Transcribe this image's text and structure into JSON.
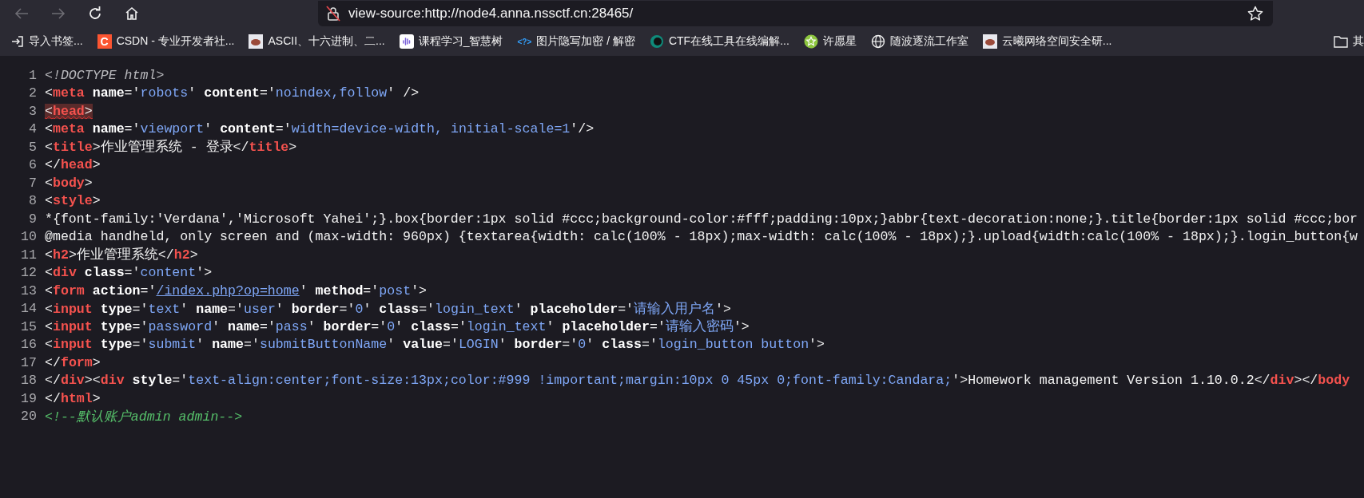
{
  "toolbar": {
    "back": {
      "disabled": true
    },
    "forward": {
      "disabled": true
    },
    "address": {
      "value": "view-source:http://node4.anna.nssctf.cn:28465/",
      "secure": false
    }
  },
  "bookmarks": [
    {
      "kind": "import",
      "label": "导入书签..."
    },
    {
      "kind": "letter",
      "letter": "C",
      "color": "#fc5531",
      "label": "CSDN - 专业开发者社..."
    },
    {
      "kind": "image",
      "label": "ASCII、十六进制、二..."
    },
    {
      "kind": "bars",
      "label": "课程学习_智慧树"
    },
    {
      "kind": "code",
      "icon_text": "<?>",
      "label": "图片隐写加密 / 解密"
    },
    {
      "kind": "ring",
      "label": "CTF在线工具在线编解..."
    },
    {
      "kind": "star",
      "label": "许愿星"
    },
    {
      "kind": "globe",
      "label": "随波逐流工作室"
    },
    {
      "kind": "image",
      "label": "云曦网络空间安全研..."
    },
    {
      "kind": "folder",
      "label": "其"
    }
  ],
  "source": {
    "lines": [
      {
        "number": "1",
        "error": false,
        "tokens": [
          {
            "kind": "doctype",
            "text": "<!DOCTYPE html>"
          }
        ]
      },
      {
        "number": "2",
        "error": false,
        "tokens": [
          {
            "kind": "punct",
            "text": "<"
          },
          {
            "kind": "tag",
            "text": "meta"
          },
          {
            "kind": "attr",
            "text": "name"
          },
          {
            "kind": "punct",
            "text": "='"
          },
          {
            "kind": "value",
            "text": "robots"
          },
          {
            "kind": "punct",
            "text": "' "
          },
          {
            "kind": "attr",
            "text": "content"
          },
          {
            "kind": "punct",
            "text": "='"
          },
          {
            "kind": "value",
            "text": "noindex,follow"
          },
          {
            "kind": "punct",
            "text": "' />"
          }
        ]
      },
      {
        "number": "3",
        "error": true,
        "tokens": [
          {
            "kind": "punct",
            "text": "<"
          },
          {
            "kind": "tag",
            "text": "head"
          },
          {
            "kind": "punct",
            "text": ">"
          }
        ]
      },
      {
        "number": "4",
        "error": false,
        "tokens": [
          {
            "kind": "punct",
            "text": "<"
          },
          {
            "kind": "tag",
            "text": "meta"
          },
          {
            "kind": "attr",
            "text": "name"
          },
          {
            "kind": "punct",
            "text": "='"
          },
          {
            "kind": "value",
            "text": "viewport"
          },
          {
            "kind": "punct",
            "text": "' "
          },
          {
            "kind": "attr",
            "text": "content"
          },
          {
            "kind": "punct",
            "text": "='"
          },
          {
            "kind": "value",
            "text": "width=device-width, initial-scale=1"
          },
          {
            "kind": "punct",
            "text": "'/>"
          }
        ]
      },
      {
        "number": "5",
        "error": false,
        "tokens": [
          {
            "kind": "punct",
            "text": "<"
          },
          {
            "kind": "tag",
            "text": "title"
          },
          {
            "kind": "punct",
            "text": ">"
          },
          {
            "kind": "text",
            "text": "作业管理系统 - 登录"
          },
          {
            "kind": "punct",
            "text": "</"
          },
          {
            "kind": "tag",
            "text": "title"
          },
          {
            "kind": "punct",
            "text": ">"
          }
        ]
      },
      {
        "number": "6",
        "error": false,
        "tokens": [
          {
            "kind": "punct",
            "text": "</"
          },
          {
            "kind": "tag",
            "text": "head"
          },
          {
            "kind": "punct",
            "text": ">"
          }
        ]
      },
      {
        "number": "7",
        "error": false,
        "tokens": [
          {
            "kind": "punct",
            "text": "<"
          },
          {
            "kind": "tag",
            "text": "body"
          },
          {
            "kind": "punct",
            "text": ">"
          }
        ]
      },
      {
        "number": "8",
        "error": false,
        "tokens": [
          {
            "kind": "punct",
            "text": "<"
          },
          {
            "kind": "tag",
            "text": "style"
          },
          {
            "kind": "punct",
            "text": ">"
          }
        ]
      },
      {
        "number": "9",
        "error": false,
        "tokens": [
          {
            "kind": "text",
            "text": "*{font-family:'Verdana','Microsoft Yahei';}.box{border:1px solid #ccc;background-color:#fff;padding:10px;}abbr{text-decoration:none;}.title{border:1px solid #ccc;bor"
          }
        ]
      },
      {
        "number": "10",
        "error": false,
        "tokens": [
          {
            "kind": "text",
            "text": "@media handheld, only screen and (max-width: 960px) {textarea{width: calc(100% - 18px);max-width: calc(100% - 18px);}.upload{width:calc(100% - 18px);}.login_button{w"
          }
        ]
      },
      {
        "number": "11",
        "error": false,
        "tokens": [
          {
            "kind": "punct",
            "text": "<"
          },
          {
            "kind": "tag",
            "text": "h2"
          },
          {
            "kind": "punct",
            "text": ">"
          },
          {
            "kind": "text",
            "text": "作业管理系统"
          },
          {
            "kind": "punct",
            "text": "</"
          },
          {
            "kind": "tag",
            "text": "h2"
          },
          {
            "kind": "punct",
            "text": ">"
          }
        ]
      },
      {
        "number": "12",
        "error": false,
        "tokens": [
          {
            "kind": "punct",
            "text": "<"
          },
          {
            "kind": "tag",
            "text": "div"
          },
          {
            "kind": "attr",
            "text": "class"
          },
          {
            "kind": "punct",
            "text": "='"
          },
          {
            "kind": "value",
            "text": "content"
          },
          {
            "kind": "punct",
            "text": "'>"
          }
        ]
      },
      {
        "number": "13",
        "error": false,
        "tokens": [
          {
            "kind": "punct",
            "text": "<"
          },
          {
            "kind": "tag",
            "text": "form"
          },
          {
            "kind": "attr",
            "text": "action"
          },
          {
            "kind": "punct",
            "text": "='"
          },
          {
            "kind": "link",
            "text": "/index.php?op=home"
          },
          {
            "kind": "punct",
            "text": "' "
          },
          {
            "kind": "attr",
            "text": "method"
          },
          {
            "kind": "punct",
            "text": "='"
          },
          {
            "kind": "value",
            "text": "post"
          },
          {
            "kind": "punct",
            "text": "'>"
          }
        ]
      },
      {
        "number": "14",
        "error": false,
        "tokens": [
          {
            "kind": "punct",
            "text": "<"
          },
          {
            "kind": "tag",
            "text": "input"
          },
          {
            "kind": "attr",
            "text": "type"
          },
          {
            "kind": "punct",
            "text": "='"
          },
          {
            "kind": "value",
            "text": "text"
          },
          {
            "kind": "punct",
            "text": "' "
          },
          {
            "kind": "attr",
            "text": "name"
          },
          {
            "kind": "punct",
            "text": "='"
          },
          {
            "kind": "value",
            "text": "user"
          },
          {
            "kind": "punct",
            "text": "' "
          },
          {
            "kind": "attr",
            "text": "border"
          },
          {
            "kind": "punct",
            "text": "='"
          },
          {
            "kind": "value",
            "text": "0"
          },
          {
            "kind": "punct",
            "text": "' "
          },
          {
            "kind": "attr",
            "text": "class"
          },
          {
            "kind": "punct",
            "text": "='"
          },
          {
            "kind": "value",
            "text": "login_text"
          },
          {
            "kind": "punct",
            "text": "' "
          },
          {
            "kind": "attr",
            "text": "placeholder"
          },
          {
            "kind": "punct",
            "text": "='"
          },
          {
            "kind": "value",
            "text": "请输入用户名"
          },
          {
            "kind": "punct",
            "text": "'>"
          }
        ]
      },
      {
        "number": "15",
        "error": false,
        "tokens": [
          {
            "kind": "punct",
            "text": "<"
          },
          {
            "kind": "tag",
            "text": "input"
          },
          {
            "kind": "attr",
            "text": "type"
          },
          {
            "kind": "punct",
            "text": "='"
          },
          {
            "kind": "value",
            "text": "password"
          },
          {
            "kind": "punct",
            "text": "' "
          },
          {
            "kind": "attr",
            "text": "name"
          },
          {
            "kind": "punct",
            "text": "='"
          },
          {
            "kind": "value",
            "text": "pass"
          },
          {
            "kind": "punct",
            "text": "' "
          },
          {
            "kind": "attr",
            "text": "border"
          },
          {
            "kind": "punct",
            "text": "='"
          },
          {
            "kind": "value",
            "text": "0"
          },
          {
            "kind": "punct",
            "text": "' "
          },
          {
            "kind": "attr",
            "text": "class"
          },
          {
            "kind": "punct",
            "text": "='"
          },
          {
            "kind": "value",
            "text": "login_text"
          },
          {
            "kind": "punct",
            "text": "' "
          },
          {
            "kind": "attr",
            "text": "placeholder"
          },
          {
            "kind": "punct",
            "text": "='"
          },
          {
            "kind": "value",
            "text": "请输入密码"
          },
          {
            "kind": "punct",
            "text": "'>"
          }
        ]
      },
      {
        "number": "16",
        "error": false,
        "tokens": [
          {
            "kind": "punct",
            "text": "<"
          },
          {
            "kind": "tag",
            "text": "input"
          },
          {
            "kind": "attr",
            "text": "type"
          },
          {
            "kind": "punct",
            "text": "='"
          },
          {
            "kind": "value",
            "text": "submit"
          },
          {
            "kind": "punct",
            "text": "' "
          },
          {
            "kind": "attr",
            "text": "name"
          },
          {
            "kind": "punct",
            "text": "='"
          },
          {
            "kind": "value",
            "text": "submitButtonName"
          },
          {
            "kind": "punct",
            "text": "' "
          },
          {
            "kind": "attr",
            "text": "value"
          },
          {
            "kind": "punct",
            "text": "='"
          },
          {
            "kind": "value",
            "text": "LOGIN"
          },
          {
            "kind": "punct",
            "text": "' "
          },
          {
            "kind": "attr",
            "text": "border"
          },
          {
            "kind": "punct",
            "text": "='"
          },
          {
            "kind": "value",
            "text": "0"
          },
          {
            "kind": "punct",
            "text": "' "
          },
          {
            "kind": "attr",
            "text": "class"
          },
          {
            "kind": "punct",
            "text": "='"
          },
          {
            "kind": "value",
            "text": "login_button button"
          },
          {
            "kind": "punct",
            "text": "'>"
          }
        ]
      },
      {
        "number": "17",
        "error": false,
        "tokens": [
          {
            "kind": "punct",
            "text": "</"
          },
          {
            "kind": "tag",
            "text": "form"
          },
          {
            "kind": "punct",
            "text": ">"
          }
        ]
      },
      {
        "number": "18",
        "error": false,
        "tokens": [
          {
            "kind": "punct",
            "text": "</"
          },
          {
            "kind": "tag",
            "text": "div"
          },
          {
            "kind": "punct",
            "text": "><"
          },
          {
            "kind": "tag",
            "text": "div"
          },
          {
            "kind": "attr",
            "text": "style"
          },
          {
            "kind": "punct",
            "text": "='"
          },
          {
            "kind": "value",
            "text": "text-align:center;font-size:13px;color:#999 !important;margin:10px 0 45px 0;font-family:Candara;"
          },
          {
            "kind": "punct",
            "text": "'>"
          },
          {
            "kind": "text",
            "text": "Homework management Version 1.10.0.2"
          },
          {
            "kind": "punct",
            "text": "</"
          },
          {
            "kind": "tag",
            "text": "div"
          },
          {
            "kind": "punct",
            "text": "></"
          },
          {
            "kind": "tag",
            "text": "body"
          }
        ]
      },
      {
        "number": "19",
        "error": false,
        "tokens": [
          {
            "kind": "punct",
            "text": "</"
          },
          {
            "kind": "tag",
            "text": "html"
          },
          {
            "kind": "punct",
            "text": ">"
          }
        ]
      },
      {
        "number": "20",
        "error": false,
        "tokens": [
          {
            "kind": "comment",
            "text": "<!--默认账户admin admin-->"
          }
        ]
      }
    ]
  }
}
